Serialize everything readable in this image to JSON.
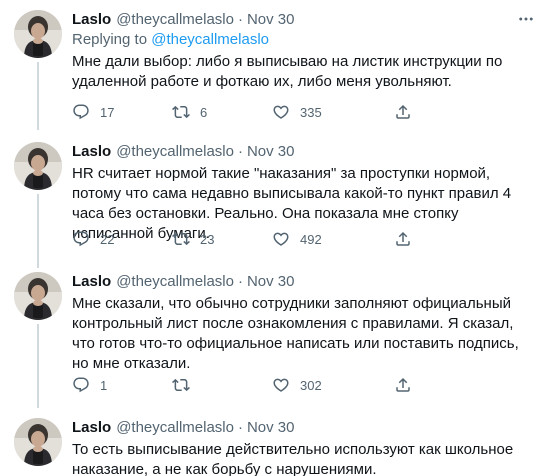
{
  "tweets": [
    {
      "name": "Laslo",
      "handle": "@theycallmelaslo",
      "date": "Nov 30",
      "reply_prefix": "Replying to ",
      "reply_to": "@theycallmelaslo",
      "text": "Мне дали выбор: либо я выписываю на листик инструкции по удаленной работе и фоткаю их, либо меня увольняют.",
      "replies": "17",
      "retweets": "6",
      "likes": "335"
    },
    {
      "name": "Laslo",
      "handle": "@theycallmelaslo",
      "date": "Nov 30",
      "text": "HR считает нормой такие \"наказания\" за проступки нормой, потому что сама недавно выписывала какой-то пункт правил 4 часа без остановки. Реально. Она показала мне стопку исписанной бумаги.",
      "replies": "22",
      "retweets": "23",
      "likes": "492"
    },
    {
      "name": "Laslo",
      "handle": "@theycallmelaslo",
      "date": "Nov 30",
      "text": "Мне сказали, что обычно сотрудники заполняют официальный контрольный лист после ознакомления с правилами. Я сказал, что готов что-то официальное написать или поставить подпись, но мне отказали.",
      "replies": "1",
      "retweets": "",
      "likes": "302"
    },
    {
      "name": "Laslo",
      "handle": "@theycallmelaslo",
      "date": "Nov 30",
      "text": "То есть выписывание действительно используют как школьное наказание, а не как борьбу с нарушениями."
    }
  ],
  "colors": {
    "text": "#0f1419",
    "secondary": "#536471",
    "link": "#1d9bf0",
    "thread_line": "#cfd9de",
    "separator": "#eff3f4"
  },
  "icons": [
    "reply-icon",
    "retweet-icon",
    "like-icon",
    "share-icon",
    "more-icon"
  ]
}
